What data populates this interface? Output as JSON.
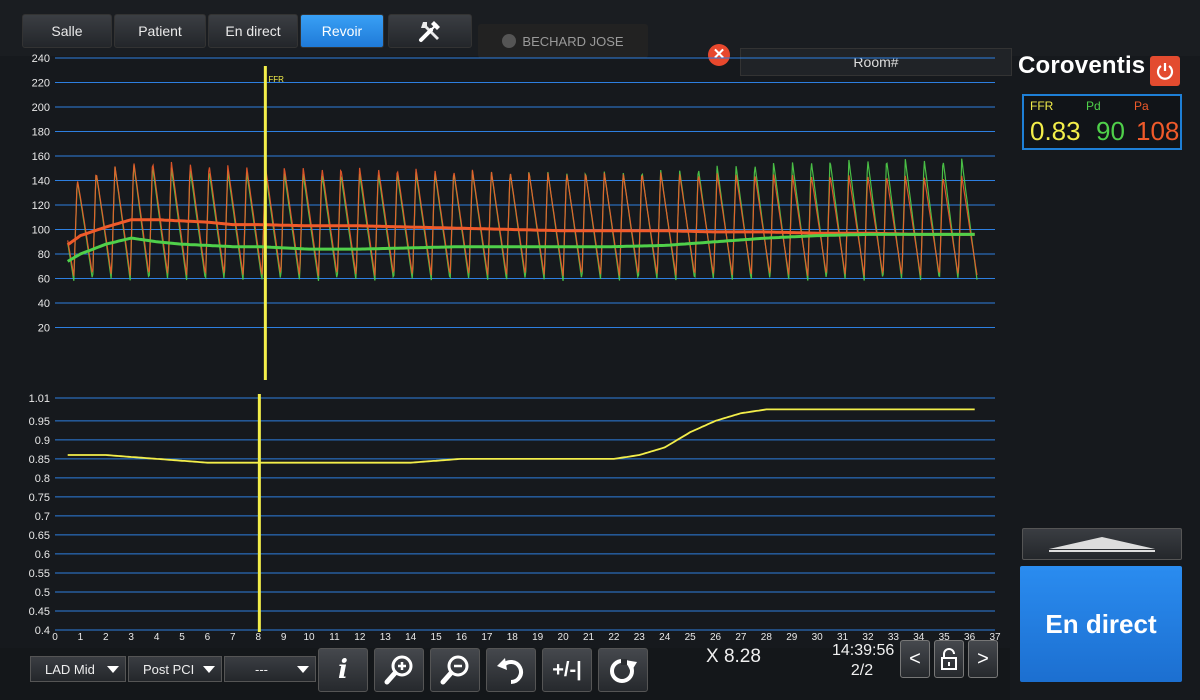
{
  "tabs": [
    {
      "label": "Salle"
    },
    {
      "label": "Patient"
    },
    {
      "label": "En direct"
    },
    {
      "label": "Revoir"
    }
  ],
  "patient_name": "BECHARD JOSE",
  "room_label": "Room#",
  "brand": "Coroventis",
  "readouts": {
    "ffr": {
      "label": "FFR",
      "value": "0.83",
      "color": "#f3ee4a"
    },
    "pd": {
      "label": "Pd",
      "value": "90",
      "color": "#4fd04a"
    },
    "pa": {
      "label": "Pa",
      "value": "108",
      "color": "#f05a2a"
    }
  },
  "marker_label": "FFR",
  "controls": {
    "vessel_select": "LAD Mid",
    "phase_select": "Post PCI",
    "extra_select": "---"
  },
  "x_readout": "X 8.28",
  "time_readout": "14:39:56",
  "page_readout": "2/2",
  "live_button": "En direct",
  "chart_data": [
    {
      "type": "line",
      "title": "",
      "xlabel": "",
      "ylabel": "",
      "ylim": [
        0,
        240
      ],
      "y_ticks": [
        "240",
        "220",
        "200",
        "180",
        "160",
        "140",
        "120",
        "100",
        "80",
        "60",
        "40",
        "20"
      ],
      "grid": true,
      "marker_x": 8.28,
      "series": [
        {
          "name": "Pa",
          "color": "#f05a2a",
          "x": [
            0,
            1,
            2,
            3,
            4,
            5,
            6,
            7,
            8,
            10,
            12,
            14,
            16,
            18,
            20,
            22,
            24,
            26,
            28,
            30,
            32,
            34,
            36
          ],
          "values": [
            80,
            95,
            102,
            108,
            108,
            107,
            106,
            104,
            104,
            103,
            103,
            102,
            101,
            100,
            99,
            99,
            99,
            98,
            98,
            97,
            97,
            96,
            96
          ]
        },
        {
          "name": "Pd",
          "color": "#4fd04a",
          "x": [
            0,
            1,
            2,
            3,
            4,
            5,
            6,
            7,
            8,
            10,
            12,
            14,
            16,
            18,
            20,
            22,
            24,
            26,
            28,
            30,
            32,
            34,
            36
          ],
          "values": [
            68,
            80,
            88,
            93,
            90,
            88,
            87,
            86,
            86,
            84,
            84,
            85,
            86,
            86,
            86,
            86,
            87,
            90,
            93,
            95,
            96,
            96,
            96
          ]
        }
      ]
    },
    {
      "type": "line",
      "title": "",
      "xlabel": "",
      "ylabel": "",
      "ylim": [
        0.4,
        1.01
      ],
      "y_ticks": [
        "1.01",
        "0.95",
        "0.9",
        "0.85",
        "0.8",
        "0.75",
        "0.7",
        "0.65",
        "0.6",
        "0.55",
        "0.5",
        "0.45",
        "0.4"
      ],
      "x_ticks": [
        "0",
        "1",
        "2",
        "3",
        "4",
        "5",
        "6",
        "7",
        "8",
        "9",
        "10",
        "11",
        "12",
        "13",
        "14",
        "15",
        "16",
        "17",
        "18",
        "19",
        "20",
        "21",
        "22",
        "23",
        "24",
        "25",
        "26",
        "27",
        "28",
        "29",
        "30",
        "31",
        "32",
        "33",
        "34",
        "35",
        "36",
        "37"
      ],
      "xlim": [
        0,
        37
      ],
      "grid": true,
      "series": [
        {
          "name": "FFR",
          "color": "#f3ee4a",
          "x": [
            0,
            2,
            4,
            6,
            8,
            10,
            12,
            14,
            16,
            18,
            20,
            22,
            23,
            24,
            25,
            26,
            27,
            28,
            30,
            32,
            34,
            35,
            36
          ],
          "values": [
            0.86,
            0.86,
            0.85,
            0.84,
            0.84,
            0.84,
            0.84,
            0.84,
            0.85,
            0.85,
            0.85,
            0.85,
            0.86,
            0.88,
            0.92,
            0.95,
            0.97,
            0.98,
            0.98,
            0.98,
            0.98,
            0.98,
            0.98
          ]
        }
      ]
    }
  ]
}
